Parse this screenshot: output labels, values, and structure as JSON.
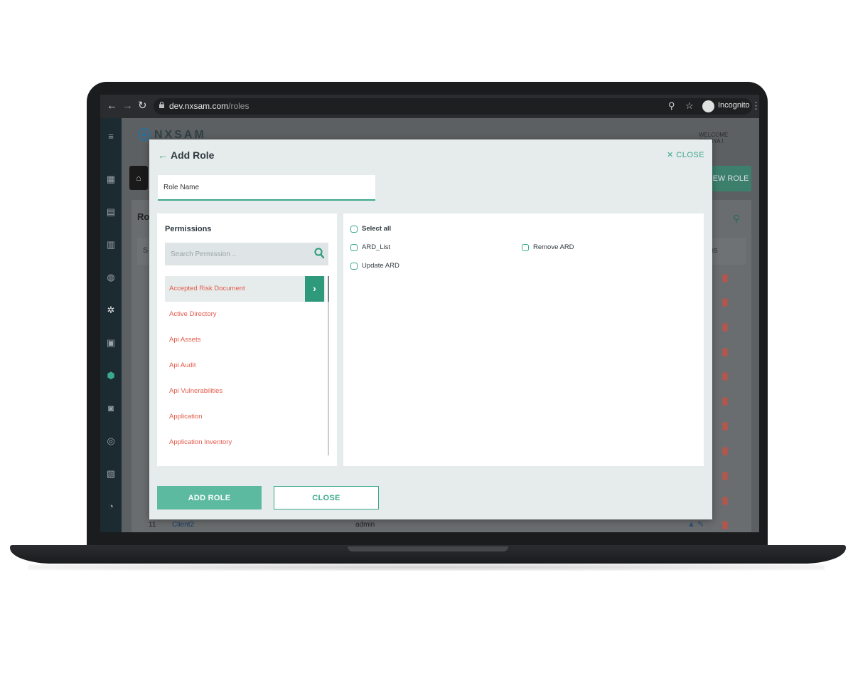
{
  "browser": {
    "url_host": "dev.nxsam.com",
    "url_path": "/roles",
    "profile_label": "Incognito"
  },
  "app": {
    "logo_text": "NXSAM",
    "welcome_line1": "WELCOME",
    "welcome_line2": "SOMIYA !",
    "new_role_label": "NEW ROLE",
    "page_title": "Rol",
    "table_header_first": "S",
    "table_header_last": "ns",
    "last_row": {
      "num": "11",
      "name": "Client2",
      "role": "admin"
    }
  },
  "modal": {
    "title": "Add Role",
    "close_top_label": "CLOSE",
    "role_name_placeholder": "Role Name",
    "permissions_title": "Permissions",
    "search_placeholder": "Search Permission ..",
    "permissions": [
      "Accepted Risk Document",
      "Active Directory",
      "Api Assets",
      "Api Audit",
      "Api Vulnerabilities",
      "Application",
      "Application Inventory"
    ],
    "selected_index": 0,
    "select_all_label": "Select all",
    "actions": [
      "ARD_List",
      "Remove ARD",
      "Update ARD"
    ],
    "add_button": "ADD ROLE",
    "close_button": "CLOSE"
  },
  "colors": {
    "accent": "#3aa88b",
    "permission_text": "#e35b4b",
    "add_button_bg": "#5bbaa0"
  }
}
